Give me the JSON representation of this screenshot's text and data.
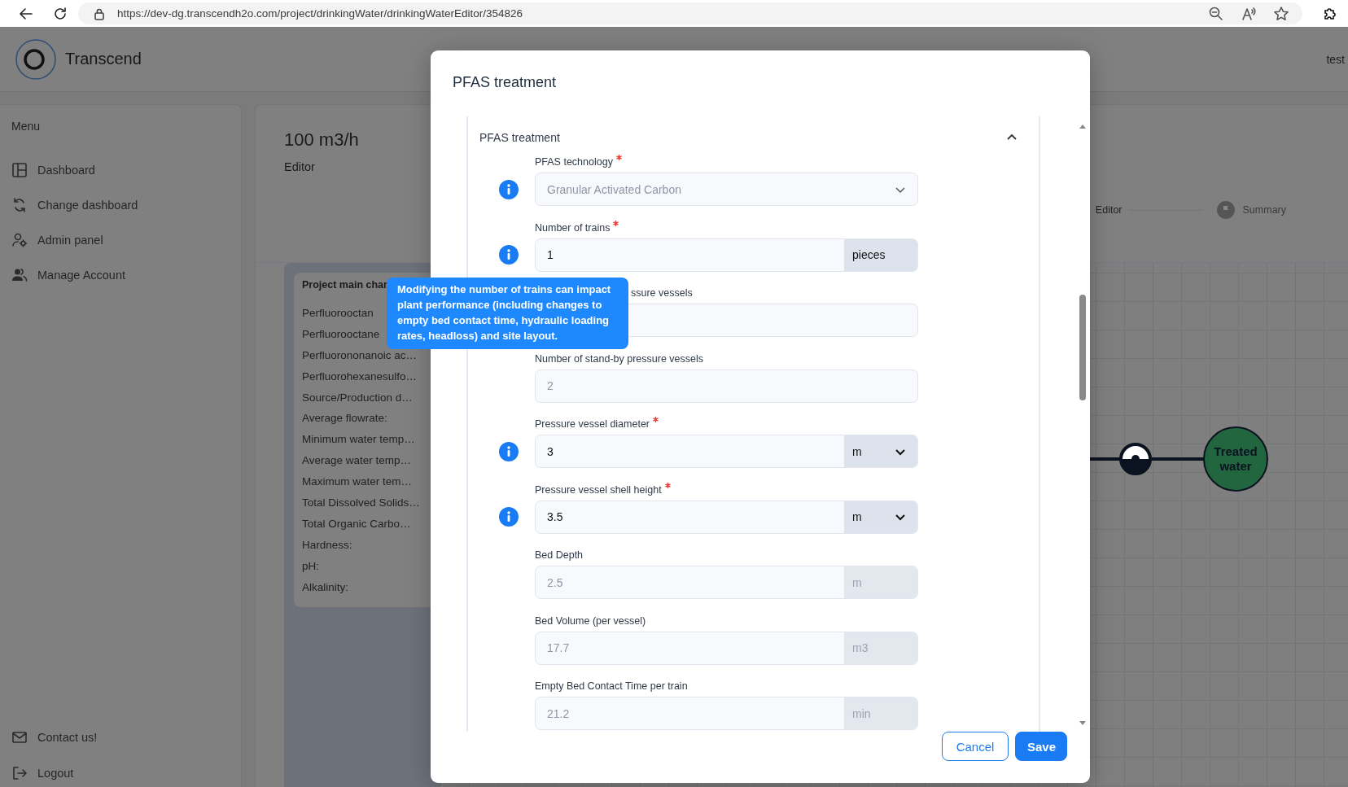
{
  "browser": {
    "url": "https://dev-dg.transcendh2o.com/project/drinkingWater/drinkingWaterEditor/354826"
  },
  "header": {
    "brand": "Transcend",
    "user": "test"
  },
  "sidebar": {
    "title": "Menu",
    "items": [
      {
        "label": "Dashboard",
        "kind": "dashboard"
      },
      {
        "label": "Change dashboard",
        "kind": "change"
      },
      {
        "label": "Admin panel",
        "kind": "admin"
      },
      {
        "label": "Manage Account",
        "kind": "account"
      }
    ],
    "footer_items": [
      {
        "label": "Contact us!",
        "kind": "mail"
      },
      {
        "label": "Logout",
        "kind": "logout"
      }
    ]
  },
  "main": {
    "title": "100 m3/h",
    "subtitle": "Editor",
    "stepper": [
      {
        "label": "Editor",
        "kind": "plain"
      },
      {
        "label": "Summary",
        "kind": "flag"
      }
    ],
    "card": {
      "title": "Project main char",
      "rows": [
        "Perfluorooctan",
        "Perfluorooctane",
        "Perfluorononanoic ac…",
        "Perfluorohexanesulfo…",
        "Source/Production d…",
        "Average flowrate:",
        "Minimum water temp…",
        "Average water temp…",
        "Maximum water tem…",
        "Total Dissolved Solids…",
        "Total Organic Carbo…",
        "Hardness:",
        "pH:",
        "Alkalinity:"
      ]
    },
    "diagram": {
      "node": "Treated water"
    }
  },
  "modal": {
    "title": "PFAS treatment",
    "section": {
      "title": "PFAS treatment",
      "expanded": true
    },
    "fields": [
      {
        "label": "PFAS technology",
        "required": true,
        "info": true,
        "kind": "select",
        "value": "Granular Activated Carbon",
        "disabled": true
      },
      {
        "label": "Number of trains",
        "required": true,
        "info": true,
        "kind": "input",
        "value": "1",
        "unit": "pieces",
        "unit_select": false,
        "disabled": false
      },
      {
        "label": "ssure vessels",
        "required": false,
        "info": false,
        "kind": "input",
        "partly_covered": true,
        "disabled": false
      },
      {
        "label": "Number of stand-by pressure vessels",
        "required": false,
        "info": false,
        "kind": "input",
        "value": "2",
        "disabled": true
      },
      {
        "label": "Pressure vessel diameter",
        "required": true,
        "info": true,
        "kind": "input",
        "value": "3",
        "unit": "m",
        "unit_select": true,
        "disabled": false
      },
      {
        "label": "Pressure vessel shell height",
        "required": true,
        "info": true,
        "kind": "input",
        "value": "3.5",
        "unit": "m",
        "unit_select": true,
        "disabled": false
      },
      {
        "label": "Bed Depth",
        "required": false,
        "info": false,
        "kind": "input",
        "value": "2.5",
        "unit": "m",
        "unit_select": false,
        "disabled": true
      },
      {
        "label": "Bed Volume (per vessel)",
        "required": false,
        "info": false,
        "kind": "input",
        "value": "17.7",
        "unit": "m3",
        "unit_select": false,
        "disabled": true
      },
      {
        "label": "Empty Bed Contact Time per train",
        "required": false,
        "info": false,
        "kind": "input",
        "value": "21.2",
        "unit": "min",
        "unit_select": false,
        "disabled": true
      }
    ],
    "tooltip": "Modifying the number of trains can impact plant performance (including changes to empty bed contact time, hydraulic loading rates, headloss) and site layout.",
    "buttons": [
      {
        "label": "Cancel",
        "kind": "secondary"
      },
      {
        "label": "Save",
        "kind": "primary"
      }
    ]
  }
}
